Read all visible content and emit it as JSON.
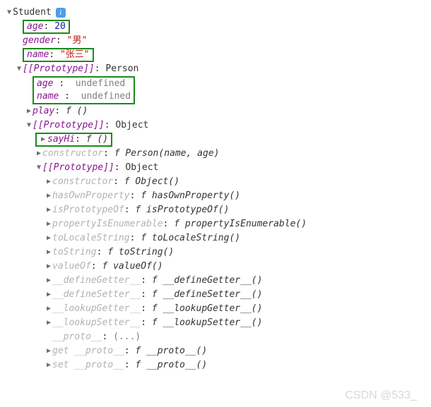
{
  "root": {
    "class": "Student",
    "age_key": "age",
    "age_val": "20",
    "gender_key": "gender",
    "gender_val": "\"男\"",
    "name_key": "name",
    "name_val": "\"张三\""
  },
  "proto1": {
    "label": "[[Prototype]]",
    "type": "Person",
    "age_key": "age",
    "age_val": "undefined",
    "name_key": "name",
    "name_val": "undefined",
    "play_key": "play",
    "play_val": "f ()"
  },
  "proto2": {
    "label": "[[Prototype]]",
    "type": "Object",
    "sayHi_key": "sayHi",
    "sayHi_val": "f ()",
    "constructor_key": "constructor",
    "constructor_val": "f Person(name, age)"
  },
  "proto3": {
    "label": "[[Prototype]]",
    "type": "Object",
    "items": [
      {
        "k": "constructor",
        "v": "f Object()"
      },
      {
        "k": "hasOwnProperty",
        "v": "f hasOwnProperty()"
      },
      {
        "k": "isPrototypeOf",
        "v": "f isPrototypeOf()"
      },
      {
        "k": "propertyIsEnumerable",
        "v": "f propertyIsEnumerable()"
      },
      {
        "k": "toLocaleString",
        "v": "f toLocaleString()"
      },
      {
        "k": "toString",
        "v": "f toString()"
      },
      {
        "k": "valueOf",
        "v": "f valueOf()"
      },
      {
        "k": "__defineGetter__",
        "v": "f __defineGetter__()"
      },
      {
        "k": "__defineSetter__",
        "v": "f __defineSetter__()"
      },
      {
        "k": "__lookupGetter__",
        "v": "f __lookupGetter__()"
      },
      {
        "k": "__lookupSetter__",
        "v": "f __lookupSetter__()"
      }
    ],
    "proto_key": "__proto__",
    "proto_val": "(...)",
    "get_proto_key": "get __proto__",
    "get_proto_val": "f __proto__()",
    "set_proto_key": "set __proto__",
    "set_proto_val": "f __proto__()"
  },
  "watermark": "CSDN @533_"
}
